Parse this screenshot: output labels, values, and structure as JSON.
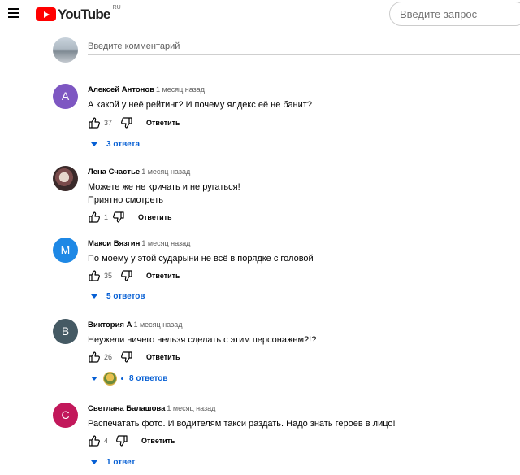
{
  "header": {
    "logo_text": "YouTube",
    "region": "RU",
    "search_placeholder": "Введите запрос"
  },
  "composer": {
    "placeholder": "Введите комментарий"
  },
  "colors": {
    "brand_red": "#ff0000",
    "link_blue": "#065fd4"
  },
  "comments": [
    {
      "avatar_letter": "А",
      "avatar_color": "#7e57c2",
      "author": "Алексей Антонов",
      "time": "1 месяц назад",
      "lines": [
        "А какой у неё рейтинг? И почему ялдекс её не банит?"
      ],
      "likes": "37",
      "reply": "Ответить",
      "replies": "3 ответа"
    },
    {
      "avatar_letter": "",
      "avatar_color": "#6d4c41",
      "author": "Лена Счастье",
      "time": "1 месяц назад",
      "lines": [
        "Можете же не кричать  и не ругаться!",
        "Приятно смотреть"
      ],
      "likes": "1",
      "reply": "Ответить"
    },
    {
      "avatar_letter": "М",
      "avatar_color": "#1e88e5",
      "author": "Макси Вязгин",
      "time": "1 месяц назад",
      "lines": [
        "По моему у этой сударыни не всё в порядке с головой"
      ],
      "likes": "35",
      "reply": "Ответить",
      "replies": "5 ответов"
    },
    {
      "avatar_letter": "В",
      "avatar_color": "#455a64",
      "author": "Виктория А",
      "time": "1 месяц назад",
      "lines": [
        "Неужели ничего нельзя сделать с этим персонажем?!?"
      ],
      "likes": "26",
      "reply": "Ответить",
      "replies": "8 ответов"
    },
    {
      "avatar_letter": "С",
      "avatar_color": "#c2185b",
      "author": "Светлана Балашова",
      "time": "1 месяц назад",
      "lines": [
        "Распечатать фото. И водителям такси раздать. Надо знать героев в лицо!"
      ],
      "likes": "4",
      "reply": "Ответить",
      "replies": "1 ответ"
    }
  ]
}
